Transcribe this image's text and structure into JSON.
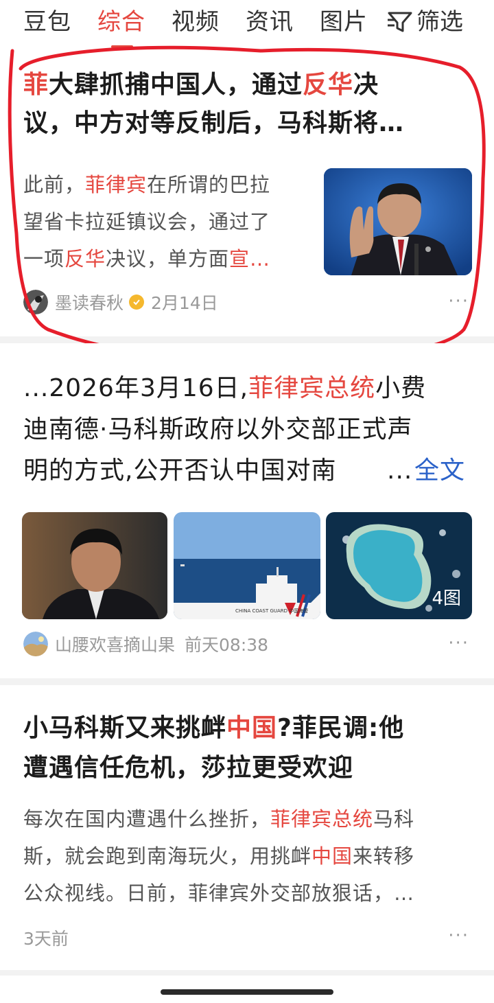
{
  "tabs": [
    {
      "label": "豆包"
    },
    {
      "label": "综合"
    },
    {
      "label": "视频"
    },
    {
      "label": "资讯"
    },
    {
      "label": "图片"
    }
  ],
  "filter": {
    "label": "筛选"
  },
  "colors": {
    "accent": "#e5473f",
    "link": "#2b62c9",
    "verified": "#f5b82e"
  },
  "card1": {
    "title_parts": [
      "菲",
      "大肆抓捕中国人，通过",
      "反华",
      "决",
      "议，中方对等反制后，马科斯将…"
    ],
    "snippet_parts": [
      "此前，",
      "菲律宾",
      "在所谓的巴拉",
      "望省卡拉延镇议会，通过了",
      "一项",
      "反华",
      "决议，单方面",
      "宣…"
    ],
    "author": "墨读春秋",
    "date": "2月14日",
    "more": "···"
  },
  "card2": {
    "text_parts": [
      "...2026年3月16日,",
      "菲律宾总统",
      "小费",
      "迪南德·马科斯政府以外交部正式声",
      "明的方式,公开否认中国对南",
      "...",
      "全文"
    ],
    "image_count": "4图",
    "ship_text": "CHINA COAST GUARD 中国海警",
    "author": "山腰欢喜摘山果",
    "time": "前天08:38",
    "more": "···"
  },
  "card3": {
    "title_parts": [
      "小马科斯又来挑衅",
      "中国",
      "?菲民调:他",
      "遭遇信任危机，莎拉更受欢迎"
    ],
    "snippet_parts": [
      "每次在国内遭遇什么挫折，",
      "菲律宾总统",
      "马科",
      "斯，就会跑到南海玩火，用挑衅",
      "中国",
      "来转移",
      "公众视线。日前，菲律宾外交部放狠话，…"
    ],
    "time": "3天前",
    "more": "···"
  }
}
